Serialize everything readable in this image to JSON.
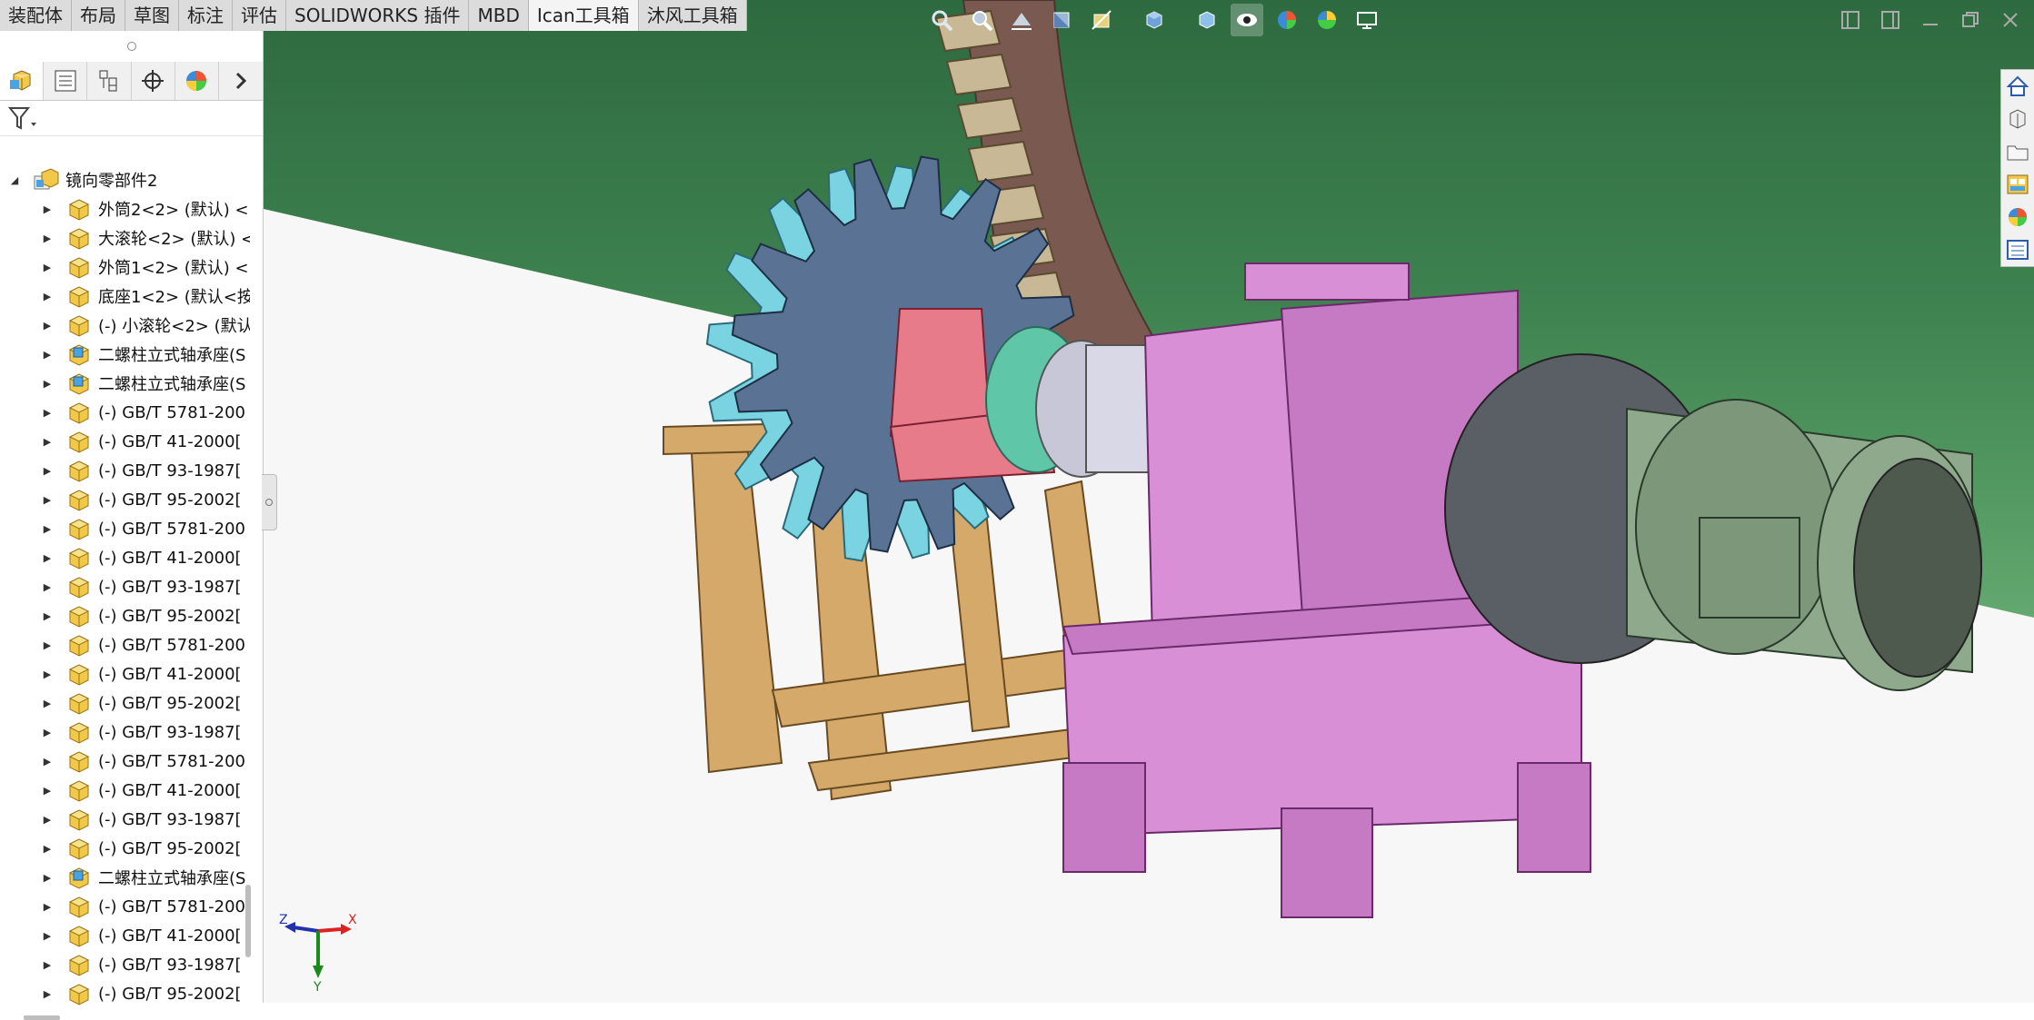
{
  "tabs": [
    {
      "label": "装配体",
      "active": false
    },
    {
      "label": "布局",
      "active": false
    },
    {
      "label": "草图",
      "active": false
    },
    {
      "label": "标注",
      "active": false
    },
    {
      "label": "评估",
      "active": false
    },
    {
      "label": "SOLIDWORKS 插件",
      "active": false
    },
    {
      "label": "MBD",
      "active": false
    },
    {
      "label": "Ican工具箱",
      "active": true
    },
    {
      "label": "沐风工具箱",
      "active": false
    }
  ],
  "panel_tabs": [
    "feature-manager-icon",
    "property-manager-icon",
    "configuration-manager-icon",
    "dimxpert-icon",
    "display-manager-icon"
  ],
  "tree": {
    "root": "镜向零部件2",
    "items": [
      {
        "label": "外筒2<2> (默认) <",
        "icon": "part"
      },
      {
        "label": "大滚轮<2> (默认) <",
        "icon": "part"
      },
      {
        "label": "外筒1<2> (默认) <",
        "icon": "part"
      },
      {
        "label": "底座1<2> (默认<按",
        "icon": "part"
      },
      {
        "label": "(-) 小滚轮<2> (默认",
        "icon": "part"
      },
      {
        "label": "二螺柱立式轴承座(S",
        "icon": "assembly"
      },
      {
        "label": "二螺柱立式轴承座(S",
        "icon": "assembly"
      },
      {
        "label": "(-) GB/T 5781-200",
        "icon": "part"
      },
      {
        "label": "(-) GB/T 41-2000[",
        "icon": "part"
      },
      {
        "label": "(-) GB/T 93-1987[",
        "icon": "part"
      },
      {
        "label": "(-) GB/T 95-2002[",
        "icon": "part"
      },
      {
        "label": "(-) GB/T 5781-200",
        "icon": "part"
      },
      {
        "label": "(-) GB/T 41-2000[",
        "icon": "part"
      },
      {
        "label": "(-) GB/T 93-1987[",
        "icon": "part"
      },
      {
        "label": "(-) GB/T 95-2002[",
        "icon": "part"
      },
      {
        "label": "(-) GB/T 5781-200",
        "icon": "part"
      },
      {
        "label": "(-) GB/T 41-2000[",
        "icon": "part"
      },
      {
        "label": "(-) GB/T 95-2002[",
        "icon": "part"
      },
      {
        "label": "(-) GB/T 93-1987[",
        "icon": "part"
      },
      {
        "label": "(-) GB/T 5781-200",
        "icon": "part"
      },
      {
        "label": "(-) GB/T 41-2000[",
        "icon": "part"
      },
      {
        "label": "(-) GB/T 93-1987[",
        "icon": "part"
      },
      {
        "label": "(-) GB/T 95-2002[",
        "icon": "part"
      },
      {
        "label": "二螺柱立式轴承座(S",
        "icon": "assembly"
      },
      {
        "label": "(-) GB/T 5781-200",
        "icon": "part"
      },
      {
        "label": "(-) GB/T 41-2000[",
        "icon": "part"
      },
      {
        "label": "(-) GB/T 93-1987[",
        "icon": "part"
      },
      {
        "label": "(-) GB/T 95-2002[",
        "icon": "part"
      }
    ]
  },
  "hud_icons": [
    "zoom-to-fit-icon",
    "zoom-area-icon",
    "previous-view-icon",
    "section-view-icon",
    "dynamic-annotation-icon",
    "view-orientation-icon",
    "display-style-icon",
    "hide-show-items-icon",
    "edit-appearance-icon",
    "apply-scene-icon",
    "view-settings-icon"
  ],
  "task_pane_icons": [
    "home-icon",
    "design-library-icon",
    "file-explorer-icon",
    "view-palette-icon",
    "appearances-icon",
    "custom-properties-icon"
  ],
  "triad": {
    "x": "X",
    "y": "Y",
    "z": "Z"
  },
  "colors": {
    "sky_top": "#2e6a3f",
    "sky_bottom": "#6fb27a",
    "floor": "#f7f7f7",
    "frame_wood": "#d4a96a",
    "gear_cyan": "#7ad3e0",
    "gear_blue": "#5a7394",
    "bearing_pink": "#e77b8a",
    "reducer_violet": "#d88fd6",
    "motor_green": "#8fa98c",
    "motor_dark": "#4d5a4d",
    "coupling_teal": "#5fc6a8",
    "rack_brown": "#7a5a50",
    "teeth_tan": "#c9b896"
  }
}
